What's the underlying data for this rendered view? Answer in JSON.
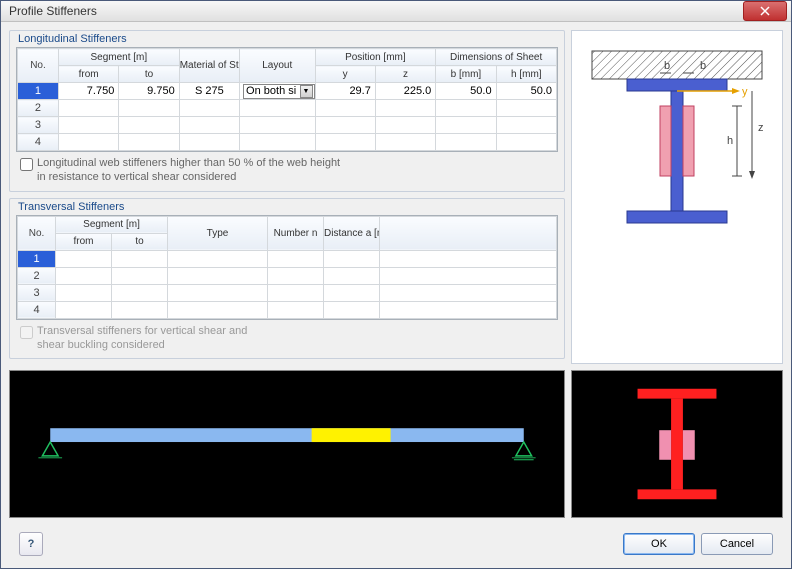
{
  "window": {
    "title": "Profile Stiffeners"
  },
  "longitudinal": {
    "legend": "Longitudinal Stiffeners",
    "headers": {
      "no": "No.",
      "segment_group": "Segment [m]",
      "segment_from": "from",
      "segment_to": "to",
      "material": "Material of Steel",
      "layout": "Layout",
      "position_group": "Position [mm]",
      "pos_y": "y",
      "pos_z": "z",
      "dims_group": "Dimensions of Sheet",
      "dim_b": "b [mm]",
      "dim_h": "h [mm]"
    },
    "rows": [
      {
        "no": "1",
        "from": "7.750",
        "to": "9.750",
        "material": "S 275",
        "layout": "On both si",
        "y": "29.7",
        "z": "225.0",
        "b": "50.0",
        "h": "50.0"
      },
      {
        "no": "2",
        "from": "",
        "to": "",
        "material": "",
        "layout": "",
        "y": "",
        "z": "",
        "b": "",
        "h": ""
      },
      {
        "no": "3",
        "from": "",
        "to": "",
        "material": "",
        "layout": "",
        "y": "",
        "z": "",
        "b": "",
        "h": ""
      },
      {
        "no": "4",
        "from": "",
        "to": "",
        "material": "",
        "layout": "",
        "y": "",
        "z": "",
        "b": "",
        "h": ""
      }
    ],
    "checkbox_label_l1": "Longitudinal web stiffeners higher than 50 % of the web height",
    "checkbox_label_l2": "in resistance to vertical shear considered",
    "checkbox_checked": false
  },
  "transversal": {
    "legend": "Transversal Stiffeners",
    "headers": {
      "no": "No.",
      "segment_group": "Segment [m]",
      "segment_from": "from",
      "segment_to": "to",
      "type": "Type",
      "number": "Number n",
      "distance": "Distance a [m]"
    },
    "rows": [
      {
        "no": "1",
        "from": "",
        "to": "",
        "type": "",
        "n": "",
        "a": ""
      },
      {
        "no": "2",
        "from": "",
        "to": "",
        "type": "",
        "n": "",
        "a": ""
      },
      {
        "no": "3",
        "from": "",
        "to": "",
        "type": "",
        "n": "",
        "a": ""
      },
      {
        "no": "4",
        "from": "",
        "to": "",
        "type": "",
        "n": "",
        "a": ""
      }
    ],
    "checkbox_label_l1": "Transversal stiffeners for vertical shear and",
    "checkbox_label_l2": "shear buckling considered",
    "checkbox_checked": false
  },
  "diagram_labels": {
    "b": "b",
    "b2": "b",
    "y": "y",
    "z": "z",
    "h": "h"
  },
  "buttons": {
    "ok": "OK",
    "cancel": "Cancel",
    "help": "?"
  }
}
